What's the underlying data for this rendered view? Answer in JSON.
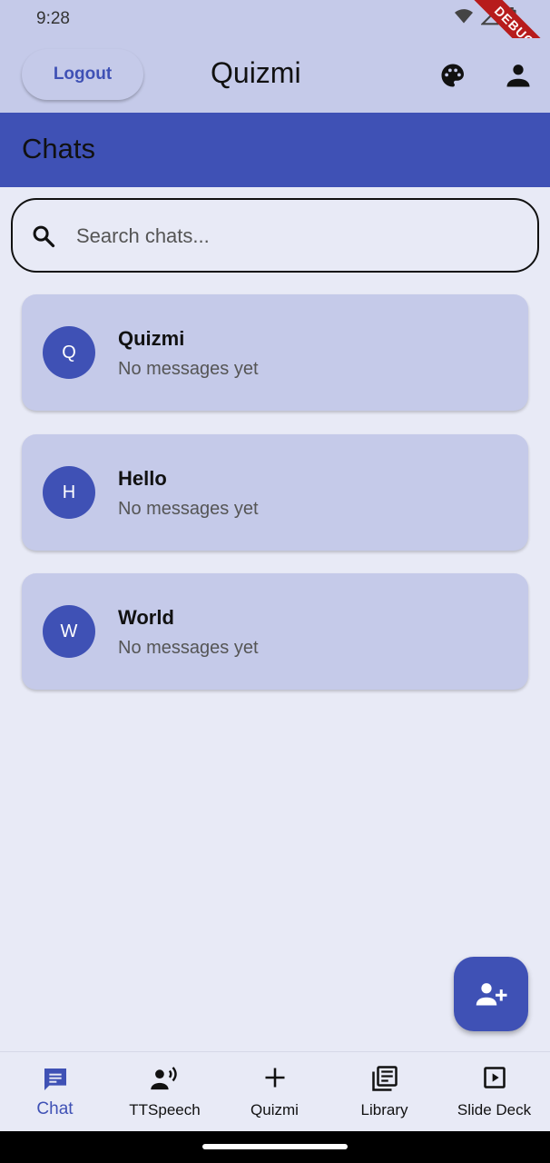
{
  "status_bar": {
    "time": "9:28",
    "debug_label": "DEBUG"
  },
  "app_bar": {
    "logout_label": "Logout",
    "title": "Quizmi"
  },
  "section": {
    "title": "Chats"
  },
  "search": {
    "placeholder": "Search chats..."
  },
  "chats": [
    {
      "initial": "Q",
      "name": "Quizmi",
      "last_message": "No messages yet"
    },
    {
      "initial": "H",
      "name": "Hello",
      "last_message": "No messages yet"
    },
    {
      "initial": "W",
      "name": "World",
      "last_message": "No messages yet"
    }
  ],
  "fab": {
    "icon": "person-add-icon"
  },
  "bottom_nav": [
    {
      "label": "Chat",
      "icon": "chat-icon",
      "active": true
    },
    {
      "label": "TTSpeech",
      "icon": "record-voice-icon",
      "active": false
    },
    {
      "label": "Quizmi",
      "icon": "add-icon",
      "active": false
    },
    {
      "label": "Library",
      "icon": "library-books-icon",
      "active": false
    },
    {
      "label": "Slide Deck",
      "icon": "slideshow-icon",
      "active": false
    }
  ],
  "colors": {
    "primary": "#3f51b5",
    "surface": "#c5cae9",
    "background": "#e8eaf6"
  }
}
